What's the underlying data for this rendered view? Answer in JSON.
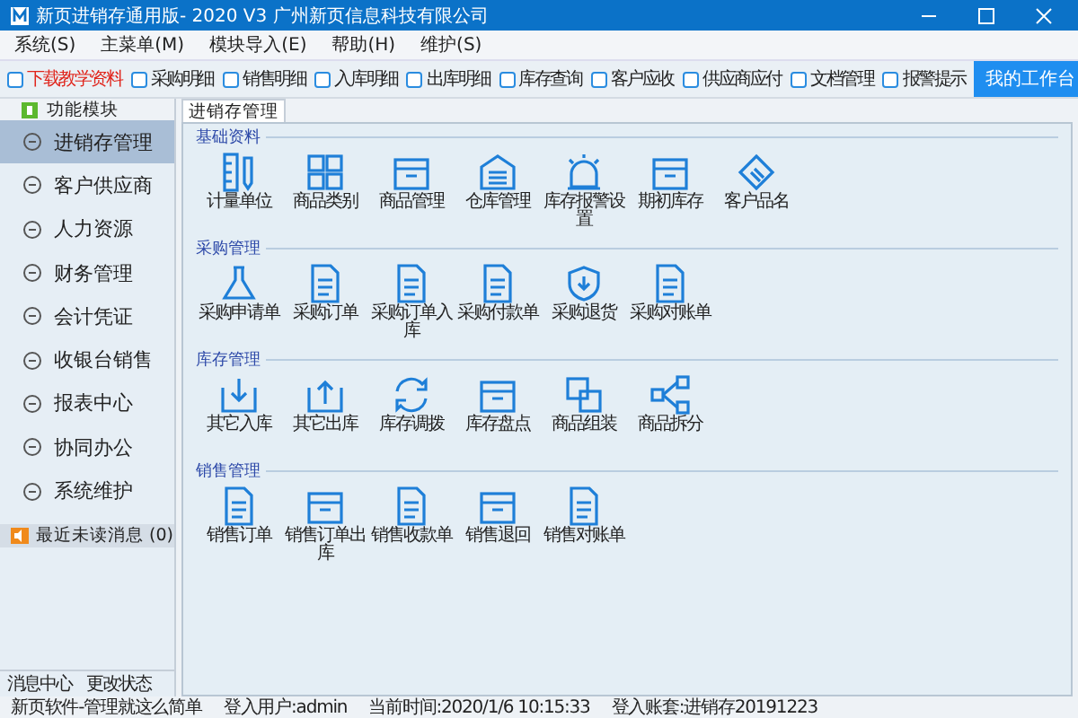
{
  "window": {
    "title": "新页进销存通用版- 2020 V3 广州新页信息科技有限公司"
  },
  "menu": [
    "系统(S)",
    "主菜单(M)",
    "模块导入(E)",
    "帮助(H)",
    "维护(S)"
  ],
  "toolbar": [
    {
      "label": "下载教学资料",
      "checked": false,
      "highlighted": true
    },
    {
      "label": "采购明细",
      "checked": false,
      "highlighted": false
    },
    {
      "label": "销售明细",
      "checked": false,
      "highlighted": false
    },
    {
      "label": "入库明细",
      "checked": false,
      "highlighted": false
    },
    {
      "label": "出库明细",
      "checked": false,
      "highlighted": false
    },
    {
      "label": "库存查询",
      "checked": false,
      "highlighted": false
    },
    {
      "label": "客户应收",
      "checked": false,
      "highlighted": false
    },
    {
      "label": "供应商应付",
      "checked": false,
      "highlighted": false
    },
    {
      "label": "文档管理",
      "checked": false,
      "highlighted": false
    },
    {
      "label": "报警提示",
      "checked": false,
      "highlighted": false
    }
  ],
  "workbench_button": "我的工作台",
  "sidebar": {
    "header": "功能模块",
    "items": [
      {
        "label": "进销存管理",
        "selected": true
      },
      {
        "label": "客户供应商",
        "selected": false
      },
      {
        "label": "人力资源",
        "selected": false
      },
      {
        "label": "财务管理",
        "selected": false
      },
      {
        "label": "会计凭证",
        "selected": false
      },
      {
        "label": "收银台销售",
        "selected": false
      },
      {
        "label": "报表中心",
        "selected": false
      },
      {
        "label": "协同办公",
        "selected": false
      },
      {
        "label": "系统维护",
        "selected": false
      }
    ],
    "messages": "最近未读消息 (0)",
    "links": [
      "消息中心",
      "更改状态"
    ]
  },
  "tab": {
    "label": "进销存管理",
    "selected": true
  },
  "sections": [
    {
      "title": "基础资料",
      "items": [
        "计量单位",
        "商品类别",
        "商品管理",
        "仓库管理",
        "库存报警设置",
        "期初库存",
        "客户品名"
      ]
    },
    {
      "title": "采购管理",
      "items": [
        "采购申请单",
        "采购订单",
        "采购订单入库",
        "采购付款单",
        "采购退货",
        "采购对账单"
      ]
    },
    {
      "title": "库存管理",
      "items": [
        "其它入库",
        "其它出库",
        "库存调拨",
        "库存盘点",
        "商品组装",
        "商品拆分"
      ]
    },
    {
      "title": "销售管理",
      "items": [
        "销售订单",
        "销售订单出库",
        "销售收款单",
        "销售退回",
        "销售对账单"
      ]
    }
  ],
  "status_bar": [
    "新页软件-管理就这么简单",
    "登入用户:admin",
    "当前时间:2020/1/6 10:15:33",
    "登入账套:进销存20191223"
  ]
}
